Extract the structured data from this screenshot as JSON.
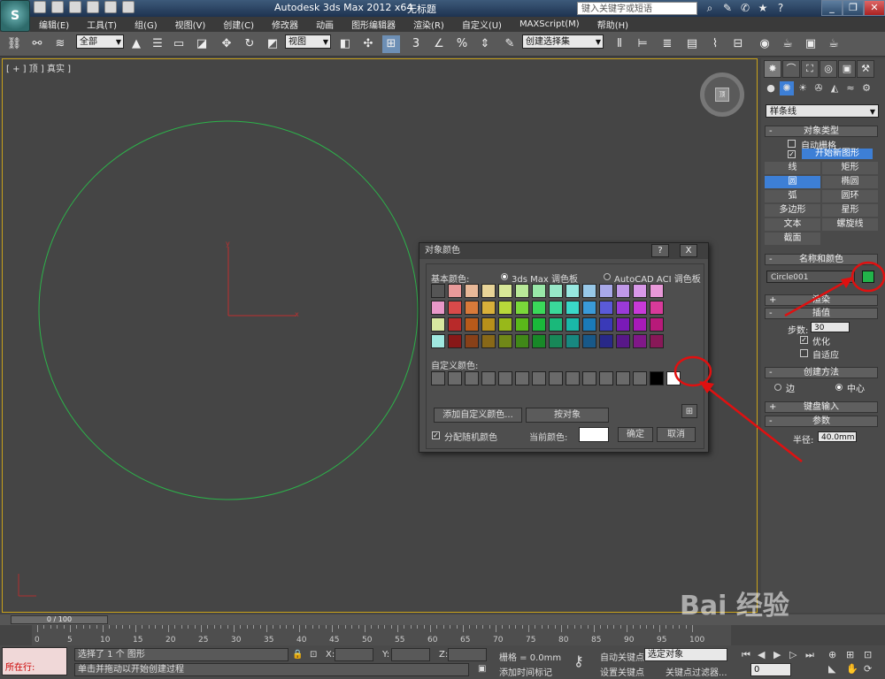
{
  "titlebar": {
    "app_title": "Autodesk 3ds Max  2012 x64",
    "document": "无标题",
    "search_placeholder": "键入关键字或短语",
    "window_buttons": [
      "_",
      "❐",
      "✕"
    ]
  },
  "menus": [
    "编辑(E)",
    "工具(T)",
    "组(G)",
    "视图(V)",
    "创建(C)",
    "修改器",
    "动画",
    "图形编辑器",
    "渲染(R)",
    "自定义(U)",
    "MAXScript(M)",
    "帮助(H)"
  ],
  "toolbar": {
    "selection_filter": "全部",
    "ref_coord": "视图",
    "named_selection": "创建选择集"
  },
  "viewport": {
    "label": "[ + ] 顶 ] 真实 ]",
    "axis_y": "y",
    "axis_x": "x"
  },
  "command_panel": {
    "category": "样条线",
    "object_type": {
      "title": "对象类型",
      "autogrid": "自动栅格",
      "start_new_shape": "开始新图形",
      "buttons": [
        "线",
        "矩形",
        "圆",
        "椭圆",
        "弧",
        "圆环",
        "多边形",
        "星形",
        "文本",
        "螺旋线",
        "截面"
      ],
      "active": "圆"
    },
    "name_color": {
      "title": "名称和颜色",
      "name": "Circle001",
      "color": "#22b34a"
    },
    "rendering": "渲染",
    "interpolation": {
      "title": "插值",
      "steps_label": "步数:",
      "steps": "30",
      "optimize": "优化",
      "adaptive": "自适应"
    },
    "creation_method": {
      "title": "创建方法",
      "edge": "边",
      "center": "中心"
    },
    "keyboard_entry": "键盘输入",
    "parameters": {
      "title": "参数",
      "radius_label": "半径:",
      "radius": "40.0mm"
    }
  },
  "dialog": {
    "title": "对象颜色",
    "help_btn": "?",
    "close_btn": "X",
    "basic_colors": "基本颜色:",
    "palette_max": "3ds Max 调色板",
    "palette_acad": "AutoCAD ACI 调色板",
    "custom_colors": "自定义颜色:",
    "add_custom": "添加自定义颜色...",
    "by_object": "按对象",
    "random_colors": "分配随机颜色",
    "current_color": "当前颜色:",
    "ok": "确定",
    "cancel": "取消",
    "selected_color": "#ffffff",
    "grid_rows": [
      [
        "#555555",
        "#e89a9a",
        "#e8b898",
        "#e8d498",
        "#d8e898",
        "#b8e898",
        "#98e8a8",
        "#98e8c8",
        "#98e8e0",
        "#98c8e8",
        "#a8a8e8",
        "#c098e8",
        "#d898e8",
        "#e898d8"
      ],
      [
        "#e898c8",
        "#d84a4a",
        "#d87a3a",
        "#d8b03a",
        "#b8d83a",
        "#7ad83a",
        "#3ad85a",
        "#3ad89a",
        "#3ad8c8",
        "#3a9ad8",
        "#5a5ad8",
        "#9a3ad8",
        "#c83ad8",
        "#d83a9a"
      ],
      [
        "#d8e8a0",
        "#b82a2a",
        "#b85a1a",
        "#b8901a",
        "#98b81a",
        "#5ab81a",
        "#1ab83a",
        "#1ab87a",
        "#1ab8a8",
        "#1a7ab8",
        "#3a3ab8",
        "#7a1ab8",
        "#a81ab8",
        "#b81a7a"
      ],
      [
        "#a0e8e0",
        "#881818",
        "#884018",
        "#886818",
        "#708818",
        "#408818",
        "#188828",
        "#188858",
        "#188880",
        "#185888",
        "#282888",
        "#581888",
        "#801888",
        "#881858"
      ]
    ],
    "custom_row": [
      "#6a6a6a",
      "#6a6a6a",
      "#6a6a6a",
      "#6a6a6a",
      "#6a6a6a",
      "#6a6a6a",
      "#6a6a6a",
      "#6a6a6a",
      "#6a6a6a",
      "#6a6a6a",
      "#6a6a6a",
      "#6a6a6a",
      "#6a6a6a",
      "#000000",
      "#ffffff"
    ]
  },
  "timeline": {
    "position": "0 / 100",
    "ticks": [
      "0",
      "5",
      "10",
      "15",
      "20",
      "25",
      "30",
      "35",
      "40",
      "45",
      "50",
      "55",
      "60",
      "65",
      "70",
      "75",
      "80",
      "85",
      "90",
      "95",
      "100"
    ]
  },
  "status": {
    "row_label": "所在行:",
    "selected": "选择了 1 个 图形",
    "prompt": "单击并拖动以开始创建过程",
    "x_label": "X:",
    "y_label": "Y:",
    "z_label": "Z:",
    "grid": "栅格 = 0.0mm",
    "auto_key": "自动关键点",
    "set_key": "设置关键点",
    "selected_obj": "选定对象",
    "key_filters": "关键点过滤器...",
    "add_time_tag": "添加时间标记",
    "frame": "0"
  },
  "watermark": "Bai 经验"
}
